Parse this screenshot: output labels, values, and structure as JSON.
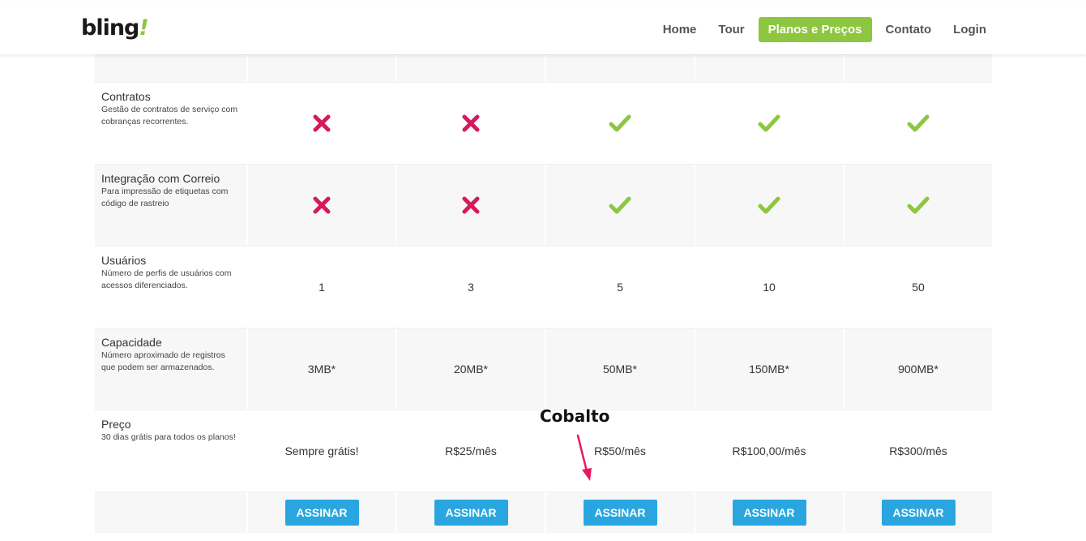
{
  "top_bar_colors": [
    "#6a3d9a",
    "#d6185c",
    "#f39c32",
    "#f7c62a",
    "#35a9e0"
  ],
  "header": {
    "logo_text": "bling",
    "logo_mark": "!",
    "nav": [
      {
        "label": "Home",
        "active": false
      },
      {
        "label": "Tour",
        "active": false
      },
      {
        "label": "Planos e Preços",
        "active": true
      },
      {
        "label": "Contato",
        "active": false
      },
      {
        "label": "Login",
        "active": false
      }
    ]
  },
  "colors": {
    "accent_green": "#8dc63f",
    "cross_red": "#d6185c",
    "button_blue": "#29a6e0"
  },
  "table": {
    "features": [
      {
        "title": "Contratos",
        "desc": "Gestão de contratos de serviço com cobranças recorrentes.",
        "type": "icon",
        "values": [
          "no",
          "no",
          "yes",
          "yes",
          "yes"
        ]
      },
      {
        "title": "Integração com Correio",
        "desc": "Para impressão de etiquetas com código de rastreio",
        "type": "icon",
        "values": [
          "no",
          "no",
          "yes",
          "yes",
          "yes"
        ]
      },
      {
        "title": "Usuários",
        "desc": "Número de perfis de usuários com acessos diferenciados.",
        "type": "text",
        "values": [
          "1",
          "3",
          "5",
          "10",
          "50"
        ]
      },
      {
        "title": "Capacidade",
        "desc": "Número aproximado de registros que podem ser armazenados.",
        "type": "text",
        "values": [
          "3MB*",
          "20MB*",
          "50MB*",
          "150MB*",
          "900MB*"
        ]
      },
      {
        "title": "Preço",
        "desc": "30 dias grátis para todos os planos!",
        "type": "text",
        "values": [
          "Sempre grátis!",
          "R$25/mês",
          "R$50/mês",
          "R$100,00/mês",
          "R$300/mês"
        ]
      }
    ],
    "button_label": "ASSINAR",
    "plan_count": 5
  },
  "annotation": {
    "label": "Cobalto",
    "color": "#e8175d"
  }
}
